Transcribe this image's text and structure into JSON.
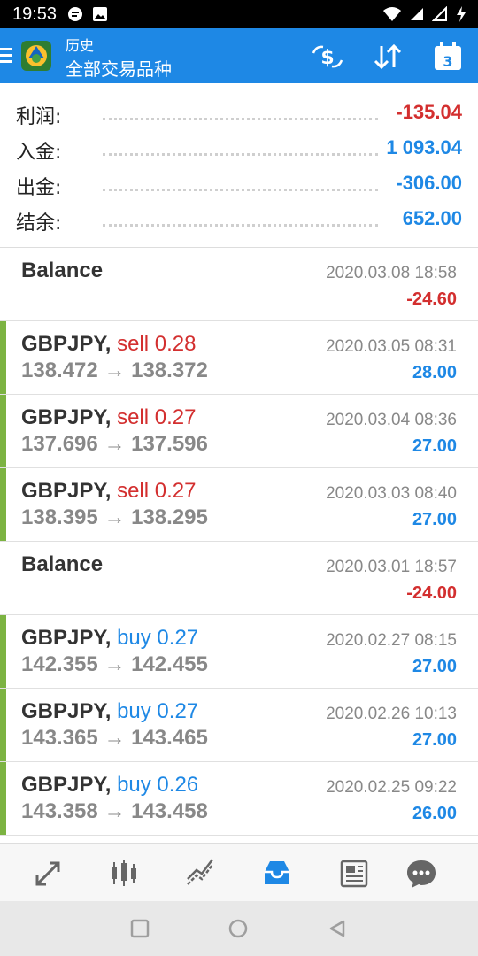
{
  "status_bar": {
    "time": "19:53"
  },
  "app_bar": {
    "subtitle": "历史",
    "title": "全部交易品种",
    "calendar_day": "3"
  },
  "summary": [
    {
      "label": "利润:",
      "value": "-135.04",
      "color": "#d32f2f"
    },
    {
      "label": "入金:",
      "value": "1 093.04",
      "color": "#1e88e5"
    },
    {
      "label": "出金:",
      "value": "-306.00",
      "color": "#1e88e5"
    },
    {
      "label": "结余:",
      "value": "652.00",
      "color": "#1e88e5"
    }
  ],
  "history": [
    {
      "type": "balance",
      "title": "Balance",
      "date": "2020.03.08 18:58",
      "profit": "-24.60"
    },
    {
      "type": "trade",
      "symbol": "GBPJPY,",
      "direction": "sell 0.28",
      "open": "138.472",
      "close": "138.372",
      "date": "2020.03.05 08:31",
      "profit": "28.00"
    },
    {
      "type": "trade",
      "symbol": "GBPJPY,",
      "direction": "sell 0.27",
      "open": "137.696",
      "close": "137.596",
      "date": "2020.03.04 08:36",
      "profit": "27.00"
    },
    {
      "type": "trade",
      "symbol": "GBPJPY,",
      "direction": "sell 0.27",
      "open": "138.395",
      "close": "138.295",
      "date": "2020.03.03 08:40",
      "profit": "27.00"
    },
    {
      "type": "balance",
      "title": "Balance",
      "date": "2020.03.01 18:57",
      "profit": "-24.00"
    },
    {
      "type": "trade",
      "symbol": "GBPJPY,",
      "direction": "buy 0.27",
      "open": "142.355",
      "close": "142.455",
      "date": "2020.02.27 08:15",
      "profit": "27.00"
    },
    {
      "type": "trade",
      "symbol": "GBPJPY,",
      "direction": "buy 0.27",
      "open": "143.365",
      "close": "143.465",
      "date": "2020.02.26 10:13",
      "profit": "27.00"
    },
    {
      "type": "trade",
      "symbol": "GBPJPY,",
      "direction": "buy 0.26",
      "open": "143.358",
      "close": "143.458",
      "date": "2020.02.25 09:22",
      "profit": "26.00"
    }
  ],
  "arrow": "→",
  "bottom_nav": [
    "quotes-icon",
    "chart-icon",
    "trade-icon",
    "history-icon",
    "news-icon",
    "chat-icon"
  ],
  "colors": {
    "accent": "#1e88e5",
    "sell": "#d32f2f",
    "buy": "#1e88e5",
    "trade_bar": "#7cb342"
  }
}
